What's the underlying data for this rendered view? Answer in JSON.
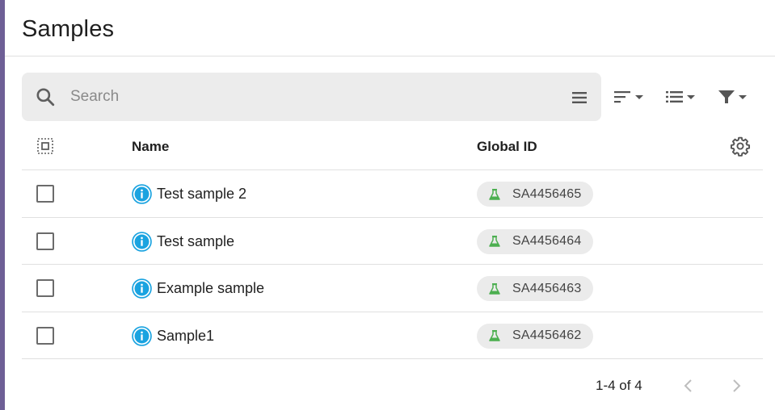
{
  "header": {
    "title": "Samples"
  },
  "search": {
    "placeholder": "Search"
  },
  "icons": {
    "search": "search-icon",
    "search_menu": "hamburger-icon",
    "sort": "sort-icon",
    "view": "list-view-icon",
    "filter": "filter-icon",
    "select_all": "select-all-icon",
    "settings": "gear-icon",
    "info": "info-icon",
    "flask": "flask-icon",
    "prev": "chevron-left-icon",
    "next": "chevron-right-icon"
  },
  "colors": {
    "accent_bar": "#6e5f96",
    "info_icon": "#1aa3e0",
    "flask_icon": "#4caf50"
  },
  "table": {
    "columns": [
      "Name",
      "Global ID"
    ],
    "rows": [
      {
        "name": "Test sample 2",
        "global_id": "SA4456465",
        "checked": false
      },
      {
        "name": "Test sample",
        "global_id": "SA4456464",
        "checked": false
      },
      {
        "name": "Example sample",
        "global_id": "SA4456463",
        "checked": false
      },
      {
        "name": "Sample1",
        "global_id": "SA4456462",
        "checked": false
      }
    ]
  },
  "pagination": {
    "label": "1-4 of 4"
  }
}
